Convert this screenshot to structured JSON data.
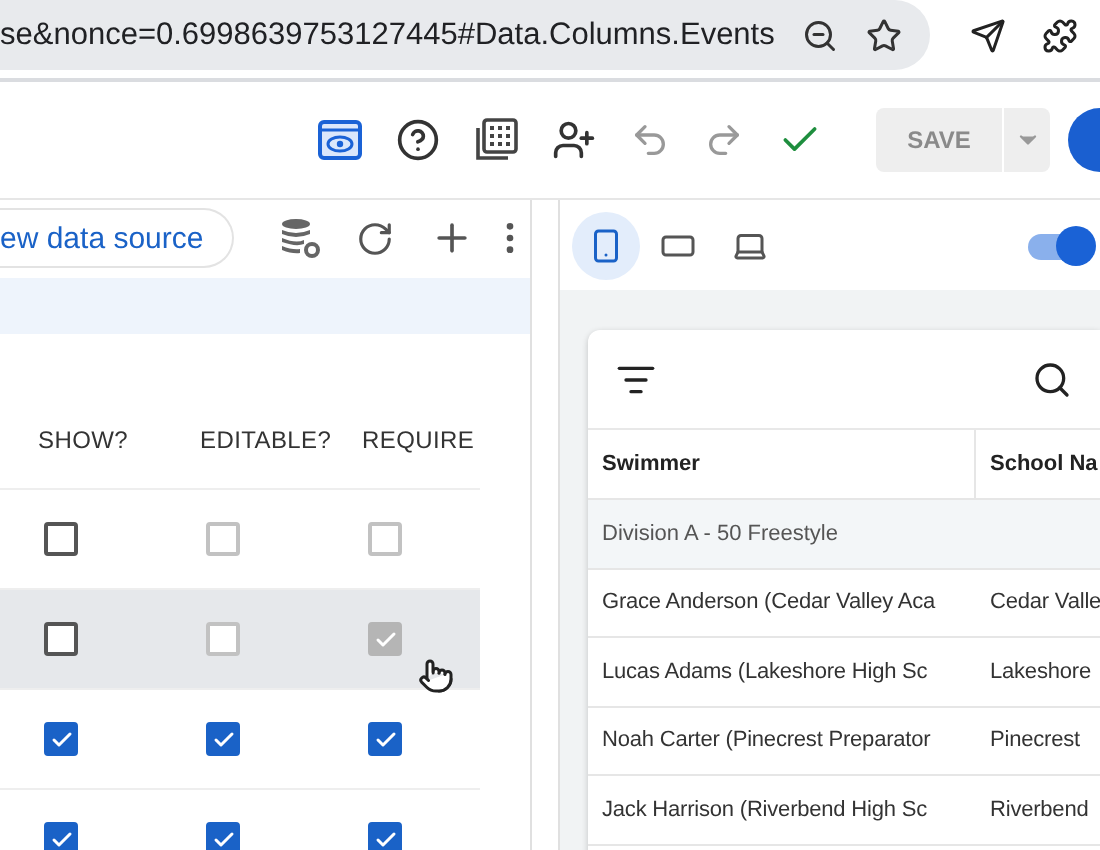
{
  "browser": {
    "url": "se&nonce=0.6998639753127445#Data.Columns.Events"
  },
  "toolbar": {
    "preview_active": true,
    "save_label": "SAVE",
    "save_disabled": true
  },
  "editor": {
    "data_source_button": "ew data source",
    "columns": [
      "SHOW?",
      "EDITABLE?",
      "REQUIRE"
    ],
    "rows": [
      {
        "selected": false,
        "cells": [
          {
            "checked": false,
            "disabled": false
          },
          {
            "checked": false,
            "disabled": true
          },
          {
            "checked": false,
            "disabled": true
          }
        ]
      },
      {
        "selected": true,
        "cells": [
          {
            "checked": false,
            "disabled": false
          },
          {
            "checked": false,
            "disabled": true
          },
          {
            "checked": true,
            "disabled": true
          }
        ]
      },
      {
        "selected": false,
        "cells": [
          {
            "checked": true,
            "disabled": false
          },
          {
            "checked": true,
            "disabled": false
          },
          {
            "checked": true,
            "disabled": false
          }
        ]
      },
      {
        "selected": false,
        "cells": [
          {
            "checked": true,
            "disabled": false
          },
          {
            "checked": true,
            "disabled": false
          },
          {
            "checked": true,
            "disabled": false
          }
        ]
      }
    ]
  },
  "preview": {
    "devices": [
      {
        "kind": "phone",
        "selected": true
      },
      {
        "kind": "tablet",
        "selected": false
      },
      {
        "kind": "laptop",
        "selected": false
      }
    ],
    "toggle_on": true,
    "table": {
      "columns": [
        "Swimmer",
        "School Na"
      ],
      "group": "Division A - 50 Freestyle",
      "rows": [
        [
          "Grace Anderson (Cedar Valley Aca",
          "Cedar Valle"
        ],
        [
          "Lucas Adams (Lakeshore High Sc",
          "Lakeshore"
        ],
        [
          "Noah Carter (Pinecrest Preparator",
          "Pinecrest"
        ],
        [
          "Jack Harrison (Riverbend High Sc",
          "Riverbend"
        ]
      ]
    }
  }
}
